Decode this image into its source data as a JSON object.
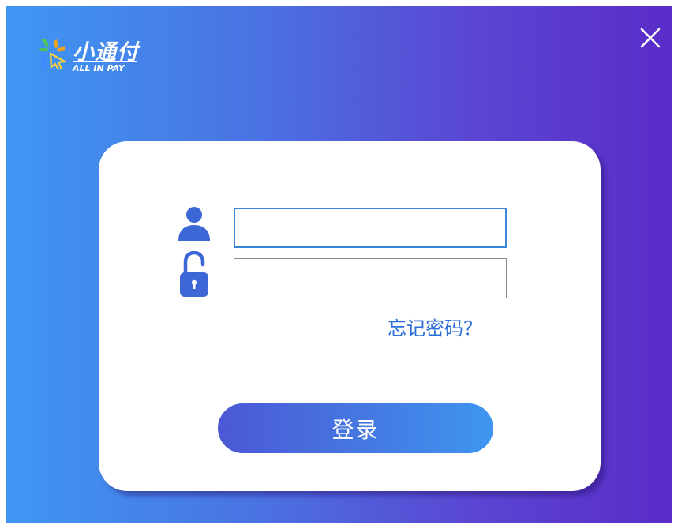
{
  "brand": {
    "name": "小通付",
    "subtitle": "ALL IN PAY",
    "logo_icon": "pinwheel-arrows-logo",
    "colors": {
      "mark_green": "#4fc25a",
      "mark_orange": "#f4a41c",
      "mark_blue": "#3d8bff",
      "mark_yellow": "#ffd23a"
    }
  },
  "window": {
    "close_icon": "close-icon",
    "gradient_start": "#3f97f3",
    "gradient_end": "#5a2cc8"
  },
  "form": {
    "username_icon": "user-icon",
    "username_value": "",
    "username_placeholder": "",
    "password_icon": "unlock-icon",
    "password_value": "",
    "password_placeholder": "",
    "forgot_password_label": "忘记密码？",
    "login_label": "登录",
    "accent_color": "#2c6fd8"
  }
}
